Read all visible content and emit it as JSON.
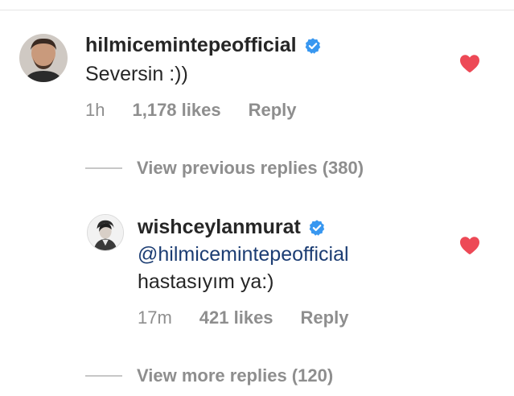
{
  "comment": {
    "username": "hilmicemintepeofficial",
    "verified": true,
    "text": "Seversin :))",
    "time": "1h",
    "likes": "1,178 likes",
    "reply_label": "Reply",
    "liked": true
  },
  "view_previous_label": "View previous replies (380)",
  "reply": {
    "username": "wishceylanmurat",
    "verified": true,
    "mention": "@hilmicemintepeofficial",
    "text": "hastasıyım ya:)",
    "time": "17m",
    "likes": "421 likes",
    "reply_label": "Reply",
    "liked": true
  },
  "view_more_label": "View more replies (120)",
  "colors": {
    "heart": "#ed4956",
    "verified": "#3897f0",
    "mention": "#1c3d73",
    "meta_text": "#8e8e8e",
    "primary_text": "#262626"
  },
  "icons": {
    "verified": "verified-badge-icon",
    "like": "heart-filled-icon"
  }
}
